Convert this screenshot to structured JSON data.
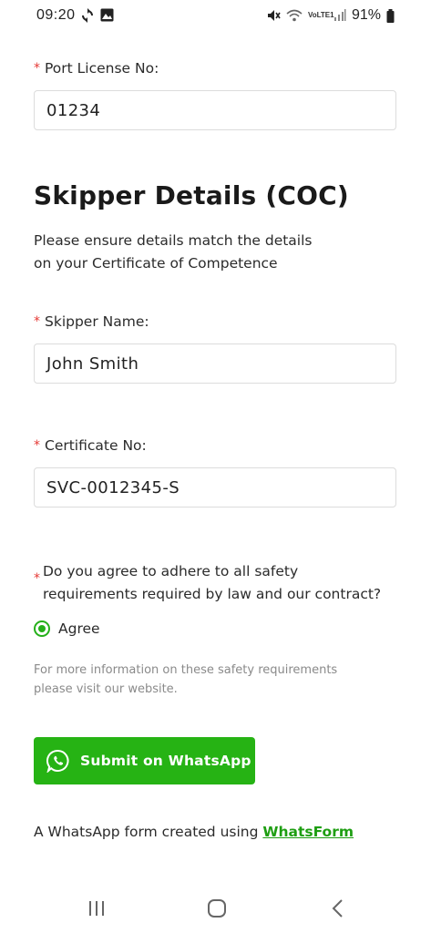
{
  "status_bar": {
    "time": "09:20",
    "battery_percent": "91%",
    "icons": [
      "sync-icon",
      "image-icon",
      "mute-icon",
      "wifi-icon",
      "volte-icon",
      "signal-icon",
      "battery-icon"
    ],
    "volte_text": "VoLTE1"
  },
  "form": {
    "port_license": {
      "label": "Port License No:",
      "value": "01234"
    },
    "skipper_section": {
      "title": "Skipper Details (COC)",
      "description_line1": "Please ensure details match the details",
      "description_line2": "on your Certificate of Competence"
    },
    "skipper_name": {
      "label": "Skipper Name:",
      "value": "John Smith"
    },
    "certificate_no": {
      "label": "Certificate No:",
      "value": "SVC-0012345-S"
    },
    "safety_question": {
      "line1": "Do you agree to adhere to all safety",
      "line2": "requirements required by law and our contract?",
      "option": "Agree",
      "selected": true
    },
    "help_text_line1": "For more information on these safety requirements",
    "help_text_line2": "please visit our website.",
    "required_marker": "*",
    "submit_label": "Submit on WhatsApp"
  },
  "footer": {
    "text": "A WhatsApp form created using ",
    "link_text": "WhatsForm"
  },
  "colors": {
    "accent": "#26b314",
    "link": "#1e9e12",
    "required": "#e53935",
    "border": "#dcdcdc"
  }
}
